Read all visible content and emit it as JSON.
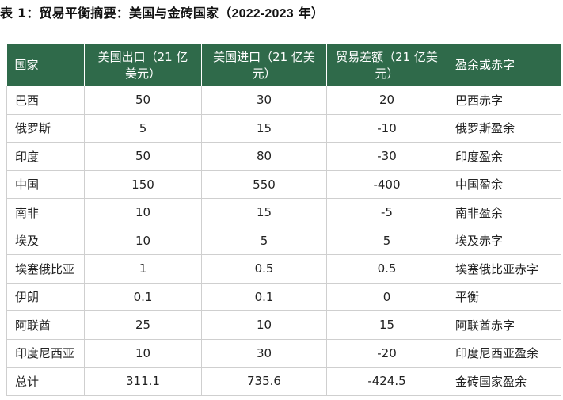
{
  "caption": {
    "prefix": "表 1：贸易平衡摘要：美国与金砖国家（",
    "years": "2022-2023",
    "suffix": " 年）"
  },
  "table": {
    "headers": [
      "国家",
      "美国出口（21 亿美元）",
      "美国进口（21 亿美元）",
      "贸易差额（21 亿美元）",
      "盈余或赤字"
    ],
    "rows": [
      [
        "巴西",
        "50",
        "30",
        "20",
        "巴西赤字"
      ],
      [
        "俄罗斯",
        "5",
        "15",
        "-10",
        "俄罗斯盈余"
      ],
      [
        "印度",
        "50",
        "80",
        "-30",
        "印度盈余"
      ],
      [
        "中国",
        "150",
        "550",
        "-400",
        "中国盈余"
      ],
      [
        "南非",
        "10",
        "15",
        "-5",
        "南非盈余"
      ],
      [
        "埃及",
        "10",
        "5",
        "5",
        "埃及赤字"
      ],
      [
        "埃塞俄比亚",
        "1",
        "0.5",
        "0.5",
        "埃塞俄比亚赤字"
      ],
      [
        "伊朗",
        "0.1",
        "0.1",
        "0",
        "平衡"
      ],
      [
        "阿联酋",
        "25",
        "10",
        "15",
        "阿联酋赤字"
      ],
      [
        "印度尼西亚",
        "10",
        "30",
        "-20",
        "印度尼西亚盈余"
      ],
      [
        "总计",
        "311.1",
        "735.6",
        "-424.5",
        "金砖国家盈余"
      ]
    ]
  },
  "colors": {
    "header_background": "#2f6a4a",
    "header_text": "#ffffff",
    "grid_lines": "#cfcfcf"
  }
}
